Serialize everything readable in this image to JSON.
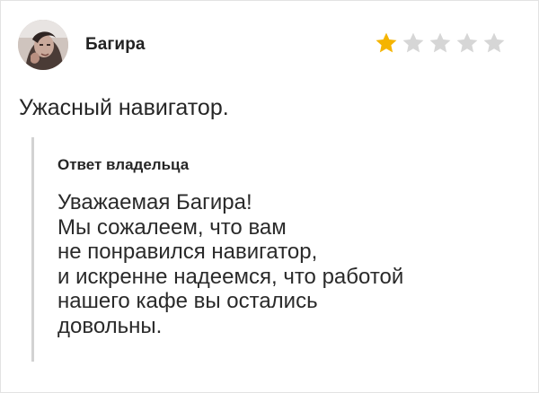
{
  "review": {
    "reviewer_name": "Багира",
    "avatar_icon": "user-photo-avatar",
    "rating": 1,
    "rating_max": 5,
    "star_icon": "star-icon",
    "colors": {
      "star_filled": "#f5b400",
      "star_empty": "#d6d6d6"
    },
    "text": "Ужасный навигатор."
  },
  "owner_reply": {
    "title": "Ответ владельца",
    "lines": [
      "Уважаемая Багира!",
      "Мы сожалеем, что вам",
      "не понравился навигатор,",
      "и искренне надеемся, что работой",
      "нашего кафе вы остались",
      "довольны."
    ]
  }
}
